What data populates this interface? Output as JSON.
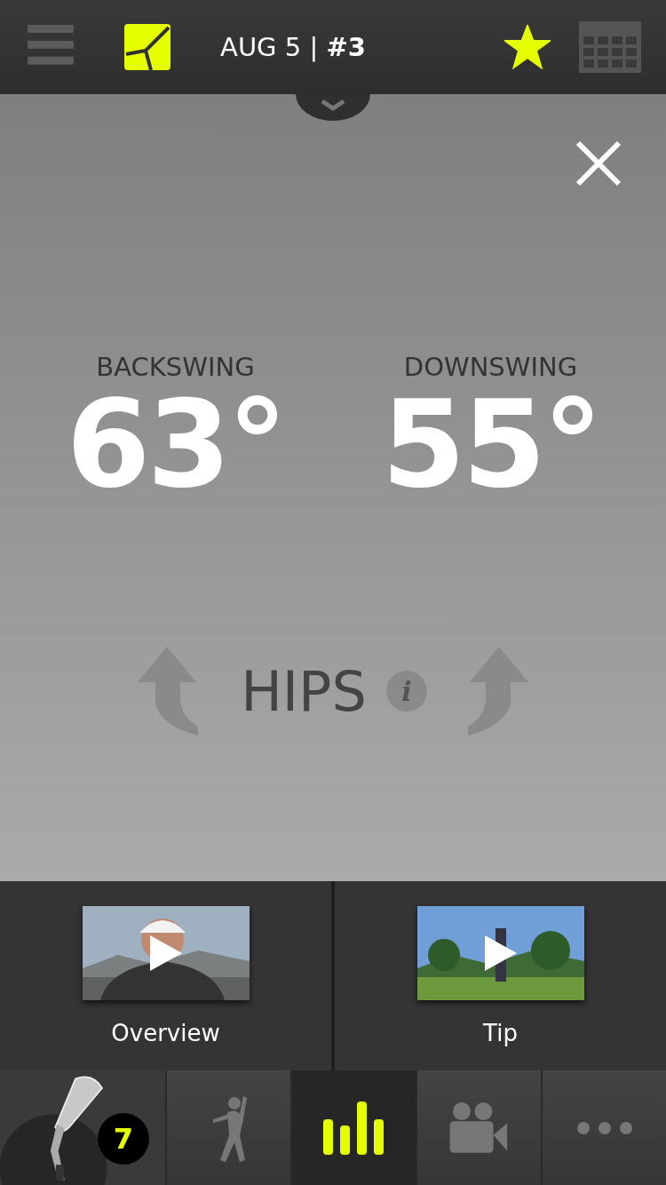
{
  "header": {
    "title": "AUG 5 | **#3**",
    "starred": true
  },
  "metrics": [
    {
      "label": "BACKSWING",
      "value": "63°"
    },
    {
      "label": "DOWNSWING",
      "value": "55°"
    }
  ],
  "body_part": {
    "label": "HIPS",
    "info": "i"
  },
  "videos": [
    {
      "title": "Overview",
      "kind": "picture"
    },
    {
      "title": "Tip",
      "kind": "picture"
    }
  ],
  "tabs": [
    {
      "kind": "club",
      "badge": "7",
      "selected": false
    },
    {
      "kind": "swing",
      "selected": false
    },
    {
      "kind": "stats",
      "selected": true
    },
    {
      "kind": "video",
      "selected": false
    },
    {
      "kind": "more",
      "selected": false
    }
  ]
}
